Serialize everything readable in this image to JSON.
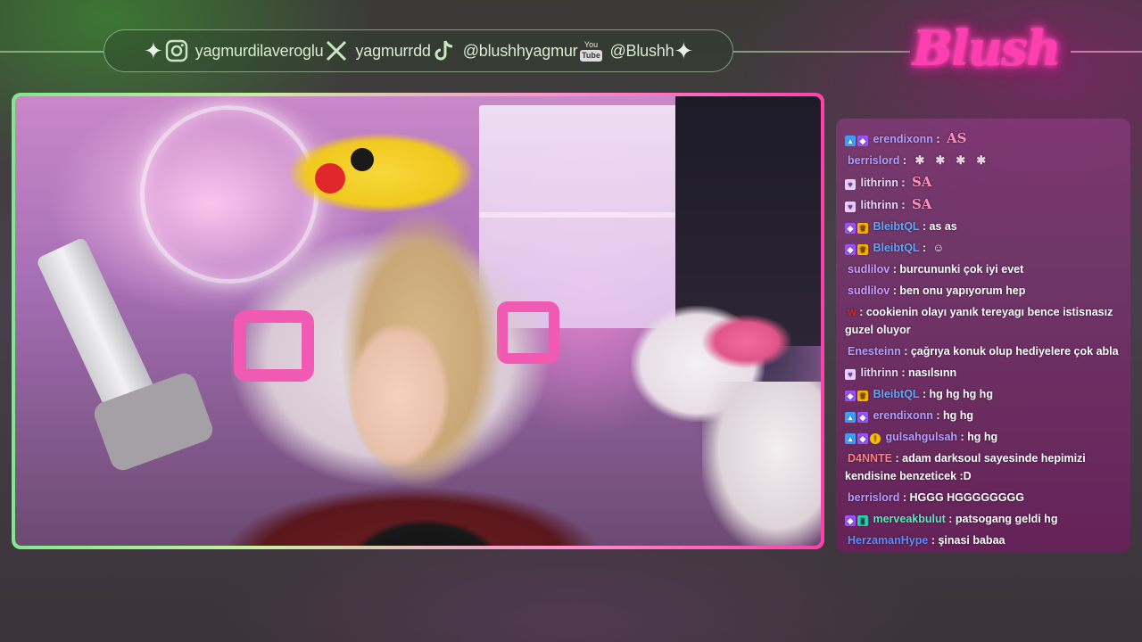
{
  "social": {
    "instagram": "yagmurdilaveroglu",
    "x": "yagmurrdd",
    "tiktok": "@blushhyagmur",
    "youtube": "@Blushh",
    "youtube_top": "You",
    "youtube_bottom": "Tube"
  },
  "logo": {
    "text": "Blush"
  },
  "chat": {
    "messages": [
      {
        "user": "erendixonn",
        "user_color": "#b19cff",
        "text": "",
        "emote": "AS"
      },
      {
        "user": "berrislord",
        "user_color": "#b19cff",
        "text": "",
        "emote": "spiders"
      },
      {
        "user": "lithrinn",
        "user_color": "#e9d6ff",
        "text": "",
        "emote": "SA"
      },
      {
        "user": "lithrinn",
        "user_color": "#e9d6ff",
        "text": "",
        "emote": "SA"
      },
      {
        "user": "BleibtQL",
        "user_color": "#5aa8ff",
        "text": "as as"
      },
      {
        "user": "BleibtQL",
        "user_color": "#5aa8ff",
        "text": "",
        "emote": "face"
      },
      {
        "user": "sudlilov",
        "user_color": "#c59bff",
        "text": "burcununki çok iyi evet"
      },
      {
        "user": "sudlilov",
        "user_color": "#c59bff",
        "text": "ben onu yapıyorum hep"
      },
      {
        "user": "w",
        "user_color": "#e0231c",
        "text": "cookienin olayı yanık tereyagı bence istisnasız guzel oluyor"
      },
      {
        "user": "Enesteinn",
        "user_color": "#b19cff",
        "text": "çağrıya konuk olup hediyelere çok abla"
      },
      {
        "user": "lithrinn",
        "user_color": "#e9d6ff",
        "text": "nasılsınn"
      },
      {
        "user": "BleibtQL",
        "user_color": "#5aa8ff",
        "text": "hg hg hg hg"
      },
      {
        "user": "erendixonn",
        "user_color": "#b19cff",
        "text": "hg hg"
      },
      {
        "user": "gulsahgulsah",
        "user_color": "#b19cff",
        "text": "hg hg"
      },
      {
        "user": "D4NNTE",
        "user_color": "#ff7a7a",
        "text": "adam darksoul sayesinde hepimizi kendisine benzeticek :D"
      },
      {
        "user": "berrislord",
        "user_color": "#b19cff",
        "text": "HGGG HGGGGGGGG"
      },
      {
        "user": "merveakbulut",
        "user_color": "#5ee8c0",
        "text": "patsogang geldi hg"
      },
      {
        "user": "HerzamanHype",
        "user_color": "#5a8cff",
        "text": "şinasi babaa"
      }
    ]
  },
  "colors": {
    "accent_pink": "#ff3fb0",
    "accent_green": "#7fe88a"
  }
}
